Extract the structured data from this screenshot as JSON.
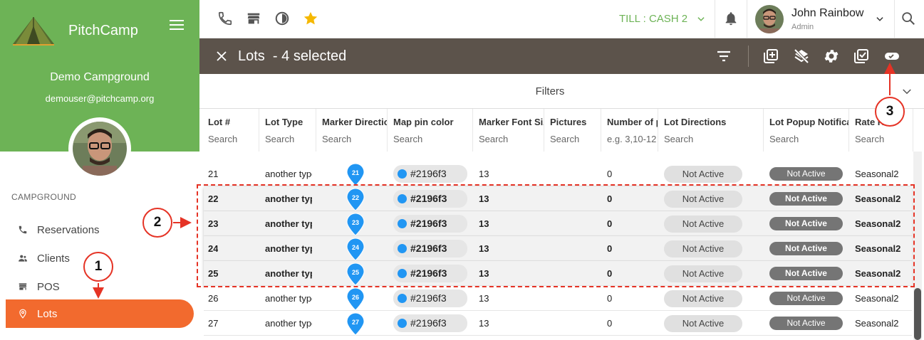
{
  "brand": {
    "name": "PitchCamp"
  },
  "campground": {
    "name": "Demo Campground",
    "email": "demouser@pitchcamp.org"
  },
  "sidebar": {
    "section": "CAMPGROUND",
    "items": [
      {
        "label": "Reservations",
        "icon": "phone-icon"
      },
      {
        "label": "Clients",
        "icon": "people-icon"
      },
      {
        "label": "POS",
        "icon": "store-icon"
      },
      {
        "label": "Lots",
        "icon": "location-pin-icon",
        "active": true
      }
    ]
  },
  "topbar": {
    "till": "TILL : CASH 2",
    "user_name": "John Rainbow",
    "user_role": "Admin"
  },
  "toolbar": {
    "title": "Lots  - 4 selected"
  },
  "filters": {
    "label": "Filters"
  },
  "table": {
    "columns": [
      {
        "title": "Lot #",
        "search": "Search"
      },
      {
        "title": "Lot Type",
        "search": "Search"
      },
      {
        "title": "Marker Direction",
        "search": "Search"
      },
      {
        "title": "Map pin color",
        "search": "Search"
      },
      {
        "title": "Marker Font Size",
        "search": "Search"
      },
      {
        "title": "Pictures",
        "search": "Search"
      },
      {
        "title": "Number of p",
        "search": "e.g. 3,10-12"
      },
      {
        "title": "Lot Directions",
        "search": "Search"
      },
      {
        "title": "Lot Popup Notification",
        "search": "Search"
      },
      {
        "title": "Rate R",
        "search": "Search"
      }
    ],
    "rows": [
      {
        "lot": "21",
        "type": "another type",
        "pin": "21",
        "color": "#2196f3",
        "font": "13",
        "num": "0",
        "directions": "Not Active",
        "popup": "Not Active",
        "rate": "Seasonal2",
        "selected": false
      },
      {
        "lot": "22",
        "type": "another type",
        "pin": "22",
        "color": "#2196f3",
        "font": "13",
        "num": "0",
        "directions": "Not Active",
        "popup": "Not Active",
        "rate": "Seasonal2",
        "selected": true
      },
      {
        "lot": "23",
        "type": "another type",
        "pin": "23",
        "color": "#2196f3",
        "font": "13",
        "num": "0",
        "directions": "Not Active",
        "popup": "Not Active",
        "rate": "Seasonal2",
        "selected": true
      },
      {
        "lot": "24",
        "type": "another type",
        "pin": "24",
        "color": "#2196f3",
        "font": "13",
        "num": "0",
        "directions": "Not Active",
        "popup": "Not Active",
        "rate": "Seasonal2",
        "selected": true
      },
      {
        "lot": "25",
        "type": "another type",
        "pin": "25",
        "color": "#2196f3",
        "font": "13",
        "num": "0",
        "directions": "Not Active",
        "popup": "Not Active",
        "rate": "Seasonal2",
        "selected": true
      },
      {
        "lot": "26",
        "type": "another type",
        "pin": "26",
        "color": "#2196f3",
        "font": "13",
        "num": "0",
        "directions": "Not Active",
        "popup": "Not Active",
        "rate": "Seasonal2",
        "selected": false
      },
      {
        "lot": "27",
        "type": "another type",
        "pin": "27",
        "color": "#2196f3",
        "font": "13",
        "num": "0",
        "directions": "Not Active",
        "popup": "Not Active",
        "rate": "Seasonal2",
        "selected": false
      }
    ]
  },
  "annotations": {
    "badges": [
      "1",
      "2",
      "3"
    ],
    "color": "#e53325"
  },
  "colors": {
    "green": "#6db356",
    "accent": "#f26a2e",
    "toolbar": "#5c534b",
    "pin": "#2196f3"
  }
}
